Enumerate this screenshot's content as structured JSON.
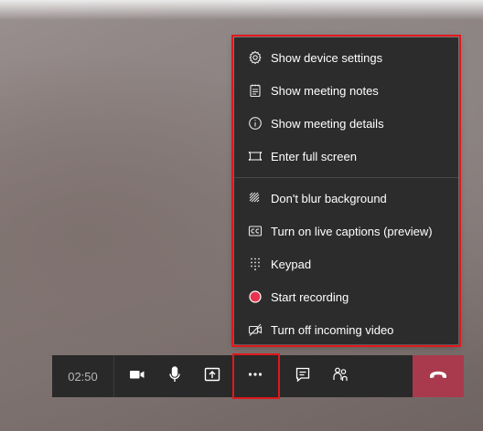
{
  "menu": {
    "items": [
      {
        "label": "Show device settings",
        "icon": "gear-icon"
      },
      {
        "label": "Show meeting notes",
        "icon": "notes-icon"
      },
      {
        "label": "Show meeting details",
        "icon": "info-icon"
      },
      {
        "label": "Enter full screen",
        "icon": "fullscreen-icon"
      },
      {
        "label": "Don't blur background",
        "icon": "blur-icon"
      },
      {
        "label": "Turn on live captions (preview)",
        "icon": "captions-icon"
      },
      {
        "label": "Keypad",
        "icon": "keypad-icon"
      },
      {
        "label": "Start recording",
        "icon": "record-icon"
      },
      {
        "label": "Turn off incoming video",
        "icon": "video-off-icon"
      }
    ]
  },
  "toolbar": {
    "timer": "02:50",
    "buttons": [
      "camera-icon",
      "microphone-icon",
      "share-screen-icon",
      "more-options-icon",
      "chat-icon",
      "participants-icon",
      "hang-up-icon"
    ]
  },
  "colors": {
    "highlight": "#e0181b",
    "menu_bg": "#2d2c2c",
    "toolbar_bg": "#2a2929",
    "hangup": "#a93a4d",
    "record": "#e8344f"
  }
}
